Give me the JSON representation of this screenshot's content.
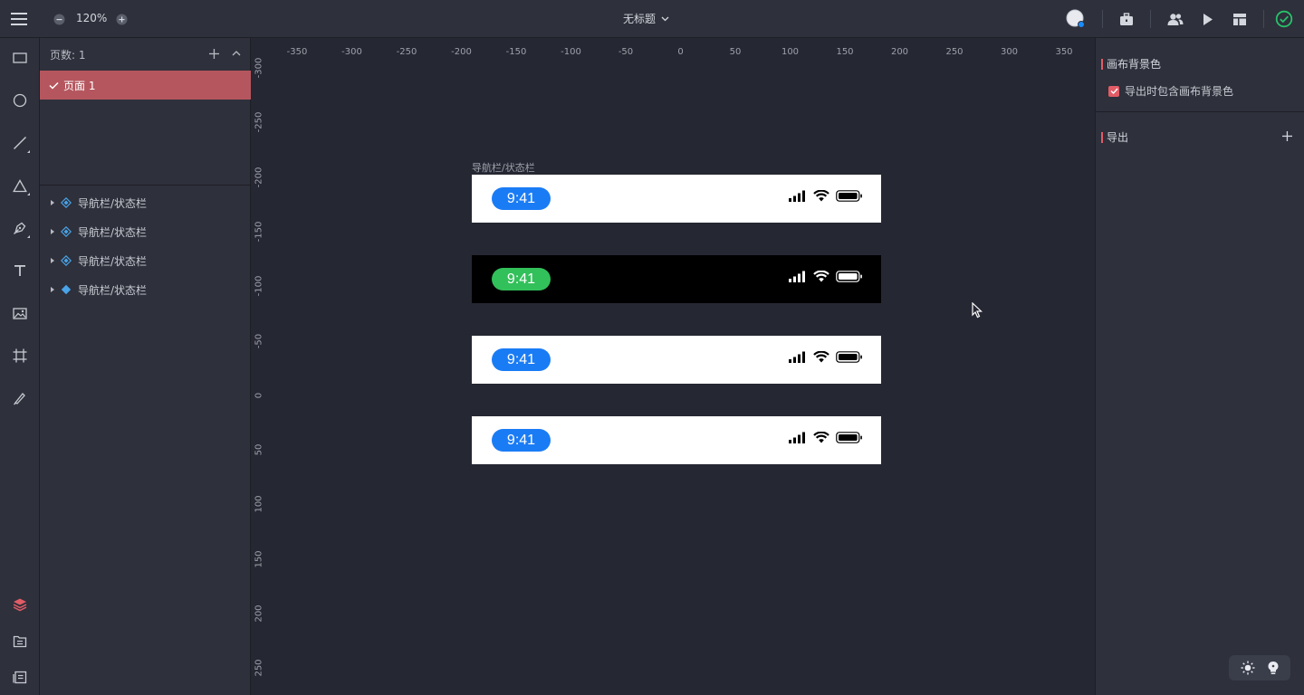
{
  "topbar": {
    "zoom": "120%",
    "title": "无标题"
  },
  "pages": {
    "header": "页数: 1",
    "active_page": "页面 1"
  },
  "layers": [
    {
      "label": "导航栏/状态栏"
    },
    {
      "label": "导航栏/状态栏"
    },
    {
      "label": "导航栏/状态栏"
    },
    {
      "label": "导航栏/状态栏"
    }
  ],
  "ruler": {
    "h_ticks": [
      "-350",
      "-300",
      "-250",
      "-200",
      "-150",
      "-100",
      "-50",
      "0",
      "50",
      "100",
      "150",
      "200",
      "250",
      "300",
      "350"
    ],
    "v_ticks": [
      "-300",
      "-250",
      "-200",
      "-150",
      "-100",
      "-50",
      "0",
      "50",
      "100",
      "150",
      "200",
      "250"
    ]
  },
  "canvas": {
    "frame_label": "导航栏/状态栏",
    "status_bars": [
      {
        "time": "9:41",
        "theme": "light",
        "pill_color": "#1a7cf5"
      },
      {
        "time": "9:41",
        "theme": "dark",
        "pill_color": "#32c05a"
      },
      {
        "time": "9:41",
        "theme": "light",
        "pill_color": "#1a7cf5"
      },
      {
        "time": "9:41",
        "theme": "light",
        "pill_color": "#1a7cf5"
      }
    ]
  },
  "right_panel": {
    "bg_section": "画布背景色",
    "include_bg_label": "导出时包含画布背景色",
    "include_bg_checked": true,
    "export_section": "导出"
  },
  "colors": {
    "accent": "#e25c66",
    "active_page_bg": "#b5565e",
    "check_ok": "#27c26a",
    "avatar_dot": "#1a8cff"
  }
}
